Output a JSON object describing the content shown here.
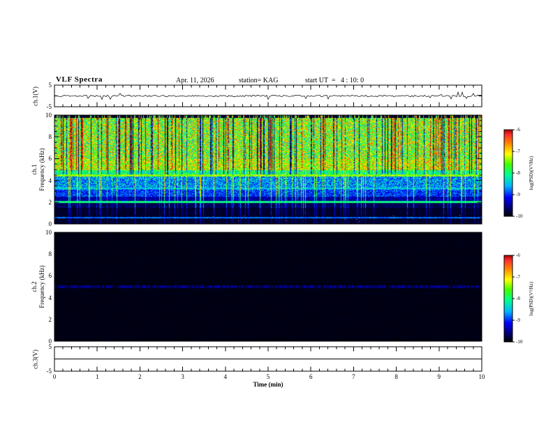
{
  "header": {
    "title": "VLF Spectra",
    "date": "Apr. 11, 2026",
    "station": "station= KAG",
    "start_ut": "start UT  =   4 : 10: 0"
  },
  "xaxis": {
    "label": "Time (min)",
    "ticks": [
      "0",
      "1",
      "2",
      "3",
      "4",
      "5",
      "6",
      "7",
      "8",
      "9",
      "10"
    ],
    "range": [
      0,
      10
    ]
  },
  "panels": {
    "ch1_voltage": {
      "label": "ch.1(V)",
      "yticks": [
        "5",
        "-5"
      ],
      "yrange": [
        -5,
        5
      ]
    },
    "ch1_spectrogram": {
      "channel": "ch.1",
      "axis": "Frequency (kHz)",
      "yticks": [
        "0",
        "2",
        "4",
        "6",
        "8",
        "10"
      ],
      "yrange": [
        0,
        10
      ]
    },
    "ch2_spectrogram": {
      "channel": "ch.2",
      "axis": "Frequency (kHz)",
      "yticks": [
        "0",
        "2",
        "4",
        "6",
        "8",
        "10"
      ],
      "yrange": [
        0,
        10
      ]
    },
    "ch3_voltage": {
      "label": "ch.3(V)",
      "yticks": [
        "5",
        "-5"
      ],
      "yrange": [
        -5,
        5
      ]
    }
  },
  "colorbar": {
    "label": "log(PSD)(V²/Hz)",
    "ticks": [
      "-6",
      "-7",
      "-8",
      "-9",
      "-10"
    ],
    "gradient": [
      {
        "pos": 0.0,
        "color": "#aa0000"
      },
      {
        "pos": 0.06,
        "color": "#ff3030"
      },
      {
        "pos": 0.16,
        "color": "#ff8800"
      },
      {
        "pos": 0.28,
        "color": "#ffff00"
      },
      {
        "pos": 0.4,
        "color": "#40ff00"
      },
      {
        "pos": 0.52,
        "color": "#00ff90"
      },
      {
        "pos": 0.65,
        "color": "#00b4ff"
      },
      {
        "pos": 0.78,
        "color": "#0000ff"
      },
      {
        "pos": 0.92,
        "color": "#00005a"
      },
      {
        "pos": 1.0,
        "color": "#000000"
      }
    ]
  },
  "chart_data": [
    {
      "type": "line",
      "title": "ch.1(V)",
      "xlabel": "Time (min)",
      "xlim": [
        0,
        10
      ],
      "ylim": [
        -5,
        5
      ],
      "description": "Noisy voltage trace fluctuating tightly around 0 V for the full 10 minutes"
    },
    {
      "type": "heatmap",
      "title": "ch.1 Frequency (kHz)",
      "xlabel": "Time (min)",
      "ylabel": "Frequency (kHz)",
      "xlim": [
        0,
        10
      ],
      "ylim": [
        0,
        10
      ],
      "zlabel": "log(PSD)(V²/Hz)",
      "zlim": [
        -10,
        -6
      ],
      "description": "Strong broadband VLF activity: dense green/yellow/red vertical striations from about 4.5 to 10 kHz with black dropout columns, blue striated background from 2 to 4.5 kHz, near-black below about 1.5 kHz with sporadic impulses; persistent narrowband horizontal lines near 4.5, 3.3, 2.0 and 0.6 kHz"
    },
    {
      "type": "heatmap",
      "title": "ch.2 Frequency (kHz)",
      "xlabel": "Time (min)",
      "ylabel": "Frequency (kHz)",
      "xlim": [
        0,
        10
      ],
      "ylim": [
        0,
        10
      ],
      "zlabel": "log(PSD)(V²/Hz)",
      "zlim": [
        -10,
        -6
      ],
      "description": "Almost entirely at or below the noise floor (black); faint intermittent dark-blue narrowband line near 5 kHz"
    },
    {
      "type": "line",
      "title": "ch.3(V)",
      "xlabel": "Time (min)",
      "xlim": [
        0,
        10
      ],
      "ylim": [
        -5,
        5
      ],
      "description": "Flat line at 0 V"
    }
  ]
}
